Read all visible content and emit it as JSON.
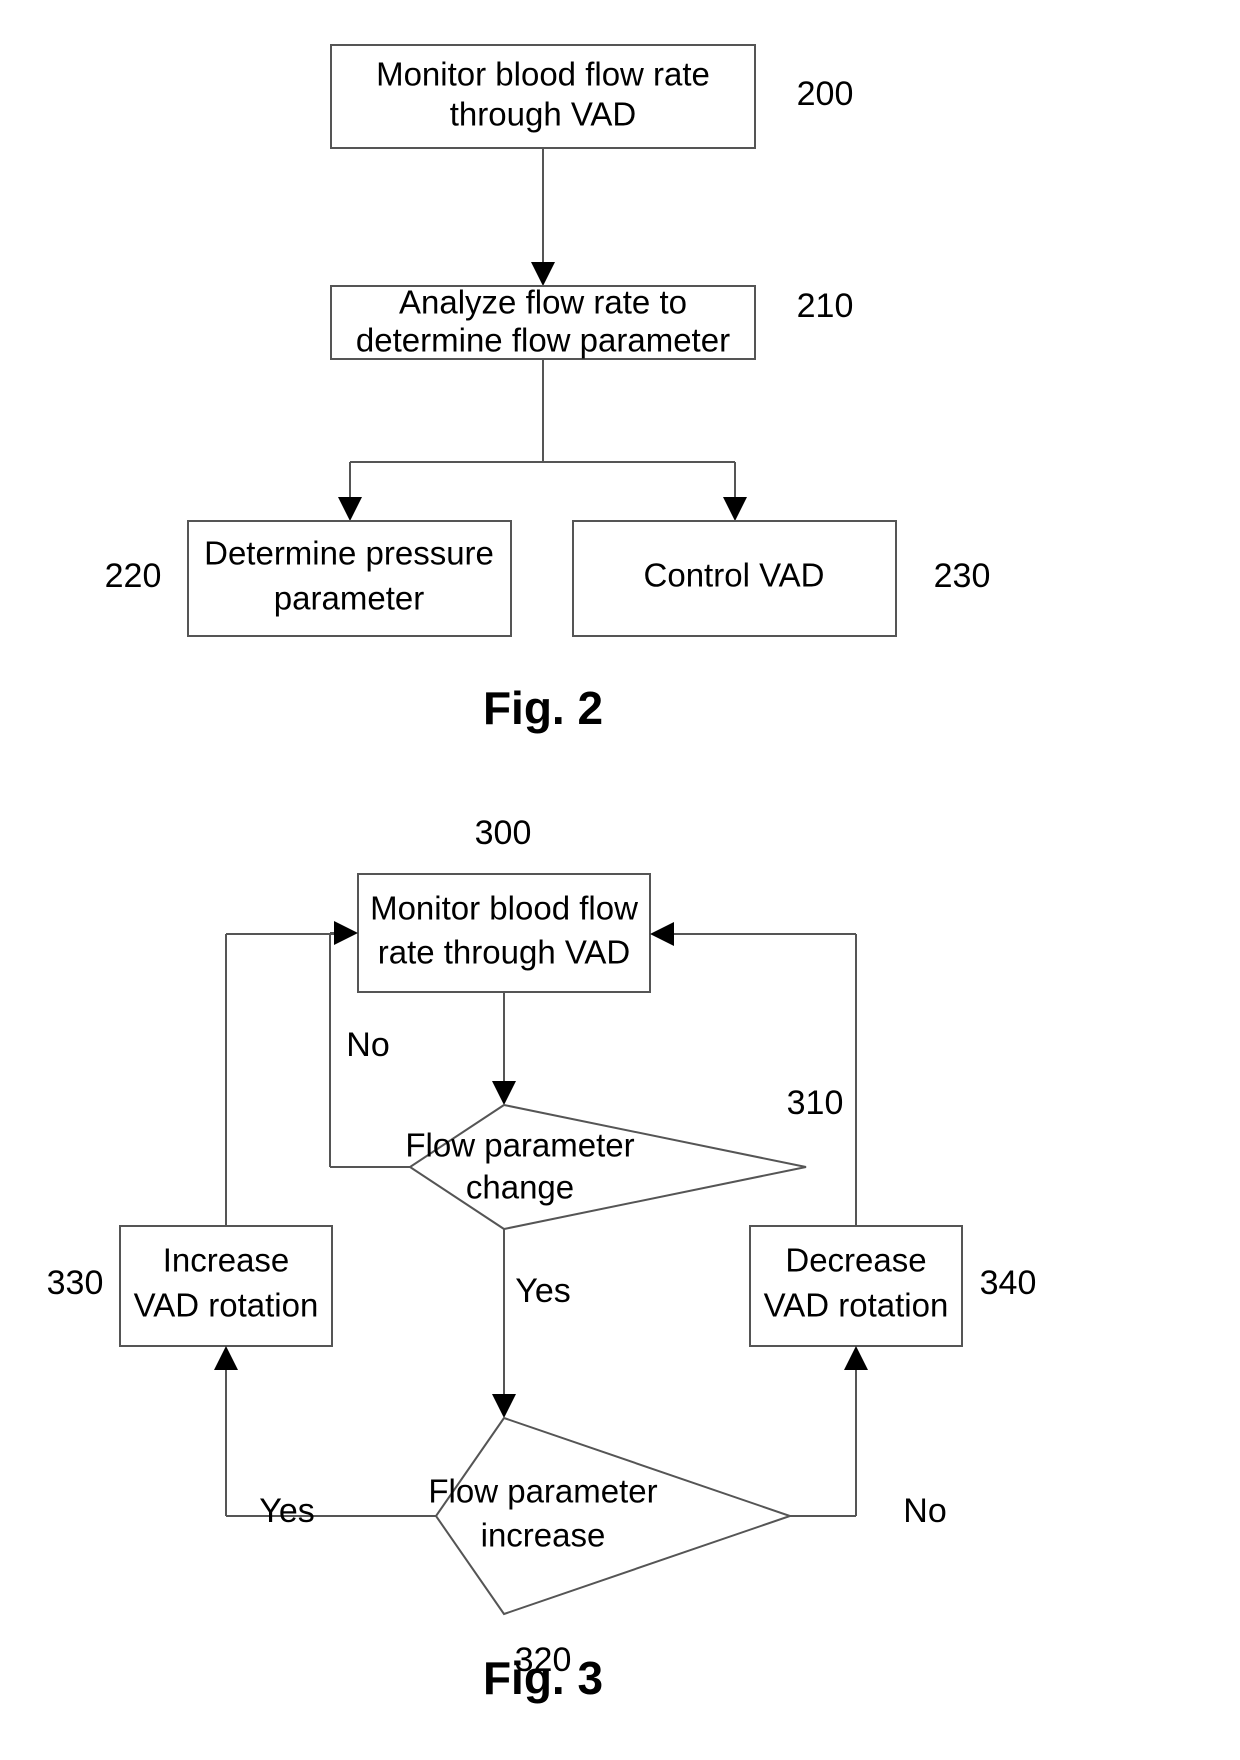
{
  "page": {
    "kind": "patent-flowchart-sheet",
    "background_color": "#ffffff",
    "line_color": "#555555",
    "text_color": "#000000"
  },
  "figures": [
    {
      "id": "fig2",
      "caption": "Fig. 2",
      "nodes": [
        {
          "id": "n200",
          "shape": "rect",
          "ref": "200",
          "lines": [
            "Monitor blood flow rate",
            "through VAD"
          ]
        },
        {
          "id": "n210",
          "shape": "rect",
          "ref": "210",
          "lines": [
            "Analyze flow rate to",
            "determine flow parameter"
          ]
        },
        {
          "id": "n220",
          "shape": "rect",
          "ref": "220",
          "lines": [
            "Determine pressure",
            "parameter"
          ]
        },
        {
          "id": "n230",
          "shape": "rect",
          "ref": "230",
          "lines": [
            "Control VAD"
          ]
        }
      ],
      "edges": [
        {
          "from": "n200",
          "to": "n210",
          "label": ""
        },
        {
          "from": "n210",
          "to": "n220",
          "label": ""
        },
        {
          "from": "n210",
          "to": "n230",
          "label": ""
        }
      ]
    },
    {
      "id": "fig3",
      "caption": "Fig. 3",
      "nodes": [
        {
          "id": "n300",
          "shape": "rect",
          "ref": "300",
          "lines": [
            "Monitor blood flow",
            "rate through VAD"
          ]
        },
        {
          "id": "n310",
          "shape": "diamond",
          "ref": "310",
          "lines": [
            "Flow parameter",
            "change"
          ]
        },
        {
          "id": "n320",
          "shape": "diamond",
          "ref": "320",
          "lines": [
            "Flow parameter",
            "increase"
          ]
        },
        {
          "id": "n330",
          "shape": "rect",
          "ref": "330",
          "lines": [
            "Increase",
            "VAD rotation"
          ]
        },
        {
          "id": "n340",
          "shape": "rect",
          "ref": "340",
          "lines": [
            "Decrease",
            "VAD rotation"
          ]
        }
      ],
      "edges": [
        {
          "from": "n300",
          "to": "n310",
          "label": ""
        },
        {
          "from": "n310",
          "to": "n300",
          "label": "No"
        },
        {
          "from": "n310",
          "to": "n320",
          "label": "Yes"
        },
        {
          "from": "n320",
          "to": "n330",
          "label": "Yes"
        },
        {
          "from": "n320",
          "to": "n340",
          "label": "No"
        },
        {
          "from": "n330",
          "to": "n300",
          "label": ""
        },
        {
          "from": "n340",
          "to": "n300",
          "label": ""
        }
      ]
    }
  ],
  "text": {
    "fig2": {
      "caption": "Fig. 2",
      "n200_l1": "Monitor blood flow rate",
      "n200_l2": "through VAD",
      "n200_ref": "200",
      "n210_l1": "Analyze flow rate to",
      "n210_l2": "determine flow parameter",
      "n210_ref": "210",
      "n220_l1": "Determine pressure",
      "n220_l2": "parameter",
      "n220_ref": "220",
      "n230_l1": "Control VAD",
      "n230_ref": "230"
    },
    "fig3": {
      "caption": "Fig. 3",
      "n300_l1": "Monitor blood flow",
      "n300_l2": "rate through VAD",
      "n300_ref": "300",
      "n310_l1": "Flow parameter",
      "n310_l2": "change",
      "n310_ref": "310",
      "n320_l1": "Flow parameter",
      "n320_l2": "increase",
      "n320_ref": "320",
      "n330_l1": "Increase",
      "n330_l2": "VAD rotation",
      "n330_ref": "330",
      "n340_l1": "Decrease",
      "n340_l2": "VAD rotation",
      "n340_ref": "340",
      "label_no_310": "No",
      "label_yes_310": "Yes",
      "label_yes_320": "Yes",
      "label_no_320": "No"
    }
  }
}
